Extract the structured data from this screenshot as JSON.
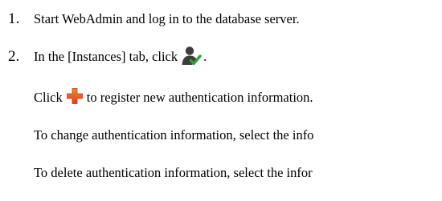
{
  "steps": [
    {
      "number": "1.",
      "text": "Start WebAdmin and log in to the database server."
    },
    {
      "number": "2.",
      "text_before_icon": "In the [Instances] tab, click",
      "icon": "user-check-icon",
      "text_after_icon": "."
    }
  ],
  "substeps": [
    {
      "text_before_icon": "Click",
      "icon": "plus-icon",
      "text_after_icon": "to register new authentication information."
    },
    {
      "text": "To change authentication information, select the info"
    },
    {
      "text": "To delete authentication information, select the infor"
    }
  ],
  "colors": {
    "text": "#000000",
    "user_icon": "#3d3d3d",
    "check_green": "#2f9e3a",
    "plus_red": "#e23b1f",
    "plus_orange": "#f28a1c"
  }
}
